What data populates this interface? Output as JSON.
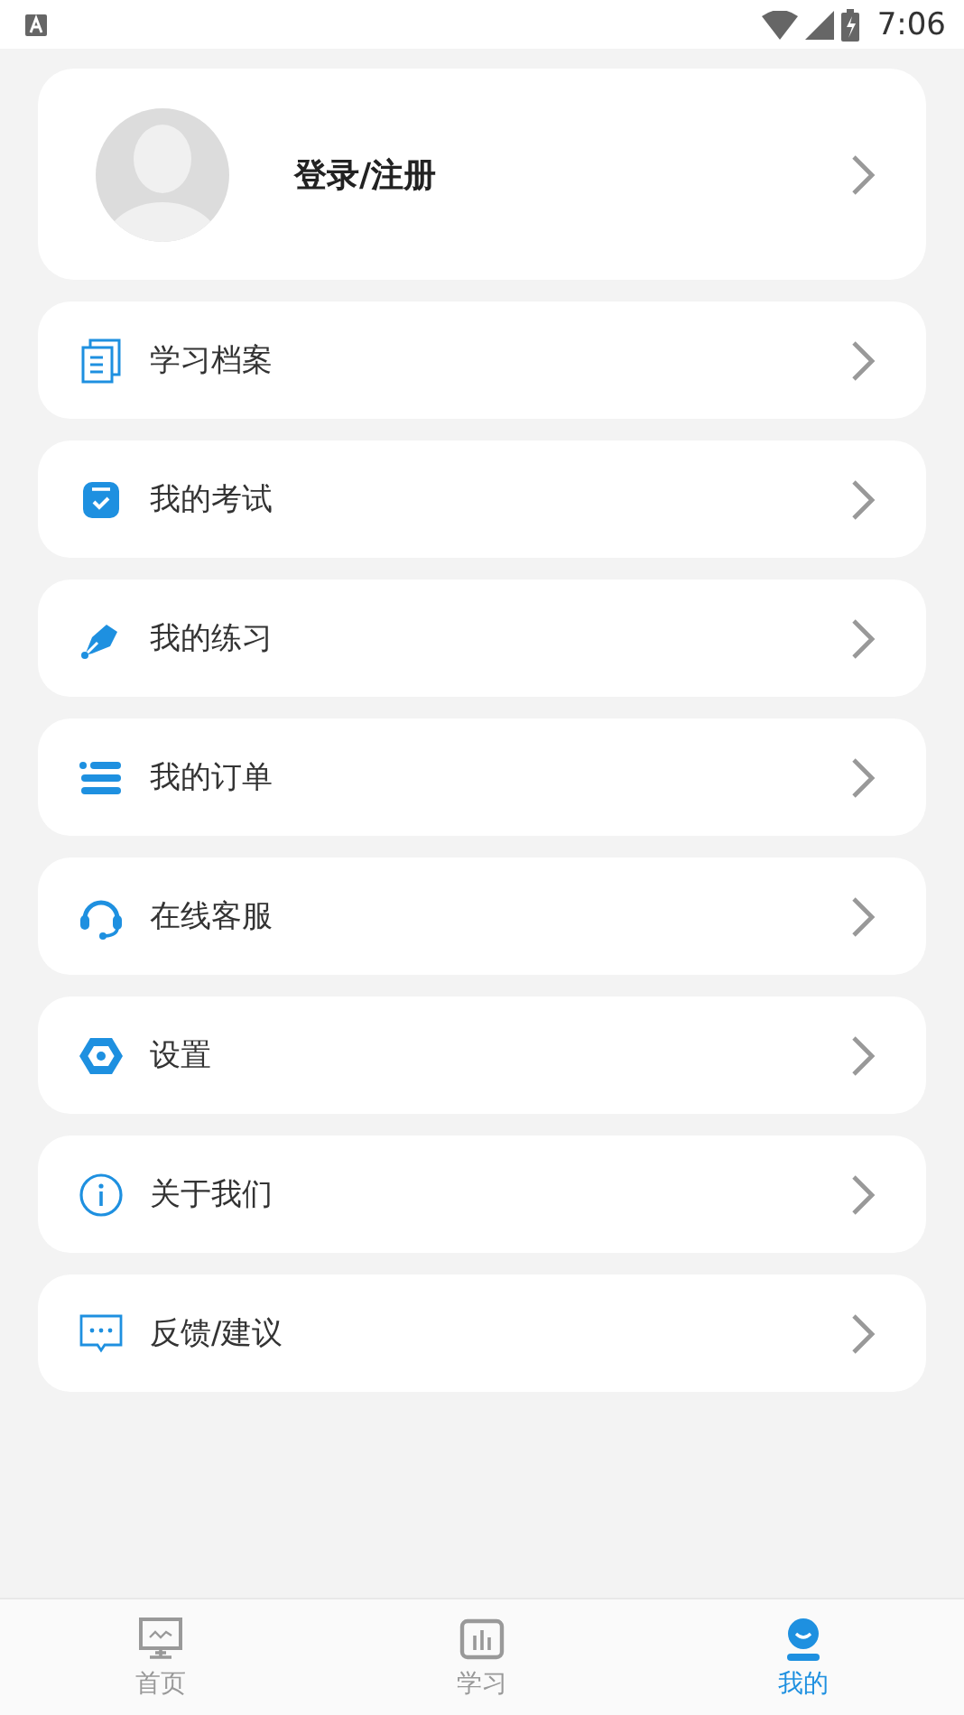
{
  "status_bar": {
    "time": "7:06"
  },
  "profile": {
    "label": "登录/注册"
  },
  "menu": [
    {
      "kind": "archive",
      "label": "学习档案"
    },
    {
      "kind": "exam",
      "label": "我的考试"
    },
    {
      "kind": "practice",
      "label": "我的练习"
    },
    {
      "kind": "orders",
      "label": "我的订单"
    },
    {
      "kind": "support",
      "label": "在线客服"
    },
    {
      "kind": "settings",
      "label": "设置"
    },
    {
      "kind": "about",
      "label": "关于我们"
    },
    {
      "kind": "feedback",
      "label": "反馈/建议"
    }
  ],
  "tab_bar": [
    {
      "kind": "home",
      "label": "首页",
      "selected": false
    },
    {
      "kind": "study",
      "label": "学习",
      "selected": false
    },
    {
      "kind": "mine",
      "label": "我的",
      "selected": true
    }
  ]
}
